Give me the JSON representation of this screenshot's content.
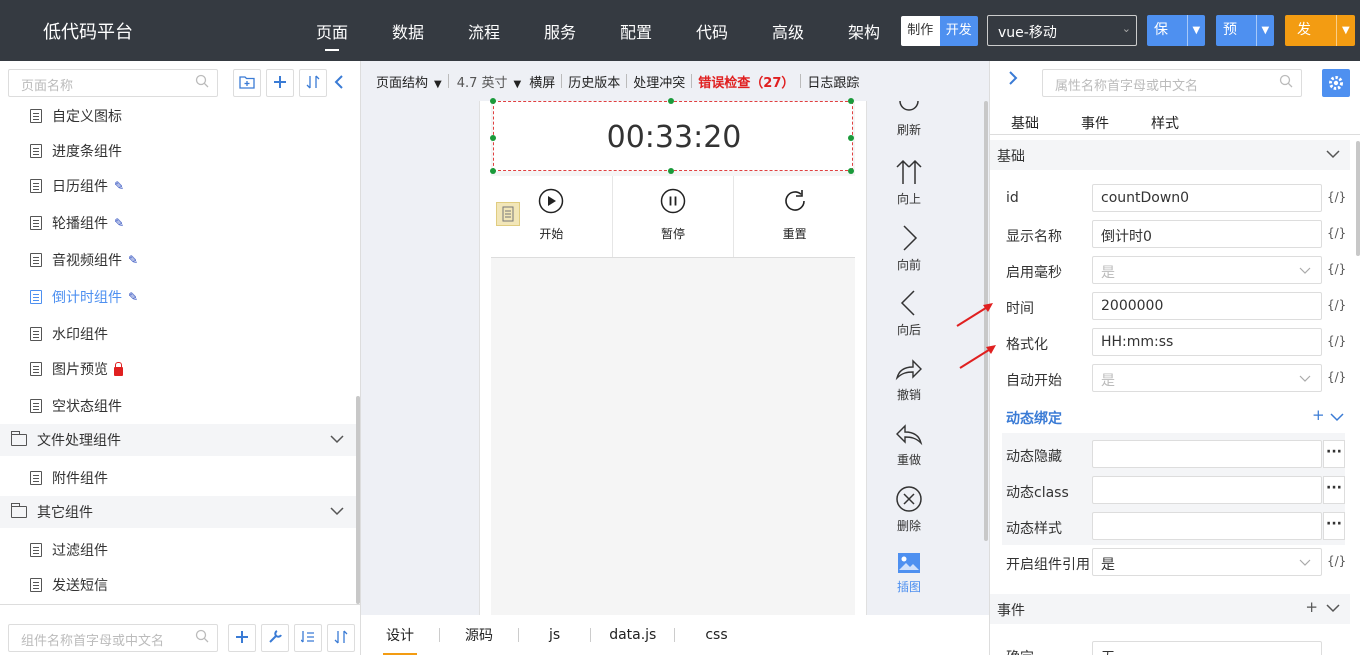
{
  "app": {
    "title": "低代码平台",
    "nav": [
      "页面",
      "数据",
      "流程",
      "服务",
      "配置",
      "代码",
      "高级",
      "架构"
    ],
    "nav_active": "页面",
    "mode_make": "制作",
    "mode_dev": "开发",
    "framework": "vue-移动",
    "save": "保存",
    "preview": "预览",
    "publish": "发布"
  },
  "left": {
    "page_search_placeholder": "页面名称",
    "items": [
      {
        "label": "自定义图标",
        "badge": ""
      },
      {
        "label": "进度条组件",
        "badge": ""
      },
      {
        "label": "日历组件",
        "badge": "pencil"
      },
      {
        "label": "轮播组件",
        "badge": "pencil"
      },
      {
        "label": "音视频组件",
        "badge": "pencil"
      },
      {
        "label": "倒计时组件",
        "badge": "pencil",
        "active": true
      },
      {
        "label": "水印组件",
        "badge": ""
      },
      {
        "label": "图片预览",
        "badge": "lock"
      },
      {
        "label": "空状态组件",
        "badge": ""
      }
    ],
    "group_file": "文件处理组件",
    "file_items": [
      "附件组件"
    ],
    "group_other": "其它组件",
    "other_items": [
      "过滤组件",
      "发送短信"
    ],
    "comp_search_placeholder": "组件名称首字母或中文名"
  },
  "canvas": {
    "toolbar": {
      "structure": "页面结构",
      "size": "4.7 英寸",
      "landscape": "横屏",
      "history": "历史版本",
      "conflict": "处理冲突",
      "error_check": "错误检查（27）",
      "log_trace": "日志跟踪"
    },
    "timer_text": "00:33:20",
    "buttons": [
      "开始",
      "暂停",
      "重置"
    ],
    "tools": [
      "刷新",
      "向上",
      "向前",
      "向后",
      "撤销",
      "重做",
      "删除",
      "插图"
    ],
    "tabs": [
      "设计",
      "源码",
      "js",
      "data.js",
      "css"
    ],
    "active_tab": "设计"
  },
  "props": {
    "search_placeholder": "属性名称首字母或中文名",
    "tabs": [
      "基础",
      "事件",
      "样式"
    ],
    "section_basic": "基础",
    "fields": {
      "id": {
        "label": "id",
        "value": "countDown0"
      },
      "display_name": {
        "label": "显示名称",
        "value": "倒计时0"
      },
      "millis": {
        "label": "启用毫秒",
        "value": "是"
      },
      "time": {
        "label": "时间",
        "value": "2000000"
      },
      "format": {
        "label": "格式化",
        "value": "HH:mm:ss"
      },
      "autostart": {
        "label": "自动开始",
        "value": "是"
      }
    },
    "expr": "{/}",
    "dyn_binding": "动态绑定",
    "dyn_hidden": "动态隐藏",
    "dyn_class": "动态class",
    "dyn_style": "动态样式",
    "comp_ref": {
      "label": "开启组件引用",
      "value": "是"
    },
    "section_events": "事件",
    "partial_label": "确定",
    "partial_value": "无"
  },
  "colors": {
    "accent": "#4e90f0",
    "publish": "#f39c12",
    "error": "#e02020",
    "topbar": "#353a41"
  }
}
